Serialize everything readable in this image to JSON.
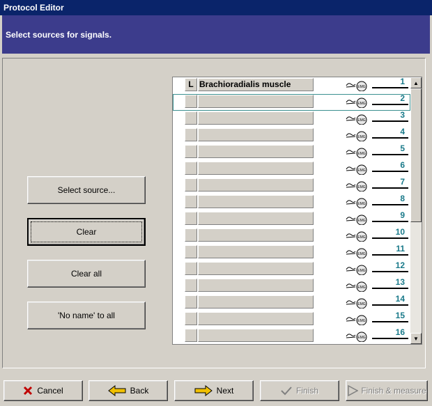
{
  "window": {
    "title": "Protocol Editor"
  },
  "header": {
    "text": "Select sources for signals."
  },
  "actions": {
    "select_source": "Select source...",
    "clear": "Clear",
    "clear_all": "Clear all",
    "no_name_to_all": "'No name' to all"
  },
  "signals": [
    {
      "side": "L",
      "name": "Brachioradialis muscle",
      "channel": "1",
      "icon": "emg-electrode-icon"
    },
    {
      "side": "",
      "name": "",
      "channel": "2",
      "icon": "emg-electrode-icon"
    },
    {
      "side": "",
      "name": "",
      "channel": "3",
      "icon": "emg-electrode-icon"
    },
    {
      "side": "",
      "name": "",
      "channel": "4",
      "icon": "emg-electrode-icon"
    },
    {
      "side": "",
      "name": "",
      "channel": "5",
      "icon": "emg-electrode-icon"
    },
    {
      "side": "",
      "name": "",
      "channel": "6",
      "icon": "emg-electrode-icon"
    },
    {
      "side": "",
      "name": "",
      "channel": "7",
      "icon": "emg-electrode-icon"
    },
    {
      "side": "",
      "name": "",
      "channel": "8",
      "icon": "emg-electrode-icon"
    },
    {
      "side": "",
      "name": "",
      "channel": "9",
      "icon": "emg-electrode-icon"
    },
    {
      "side": "",
      "name": "",
      "channel": "10",
      "icon": "emg-electrode-icon"
    },
    {
      "side": "",
      "name": "",
      "channel": "11",
      "icon": "emg-electrode-icon"
    },
    {
      "side": "",
      "name": "",
      "channel": "12",
      "icon": "emg-electrode-icon"
    },
    {
      "side": "",
      "name": "",
      "channel": "13",
      "icon": "emg-electrode-icon"
    },
    {
      "side": "",
      "name": "",
      "channel": "14",
      "icon": "emg-electrode-icon"
    },
    {
      "side": "",
      "name": "",
      "channel": "15",
      "icon": "emg-electrode-icon"
    },
    {
      "side": "",
      "name": "",
      "channel": "16",
      "icon": "emg-electrode-icon"
    }
  ],
  "selected_channel": "2",
  "navigation": {
    "cancel": "Cancel",
    "back": "Back",
    "next": "Next",
    "finish": "Finish",
    "finish_measure": "Finish & measure"
  },
  "colors": {
    "title_bar": "#0a246a",
    "header_band": "#3c3c8c",
    "channel_number": "#1a7a8a",
    "cancel_icon": "#c00000",
    "arrow_icon": "#f0c000"
  }
}
